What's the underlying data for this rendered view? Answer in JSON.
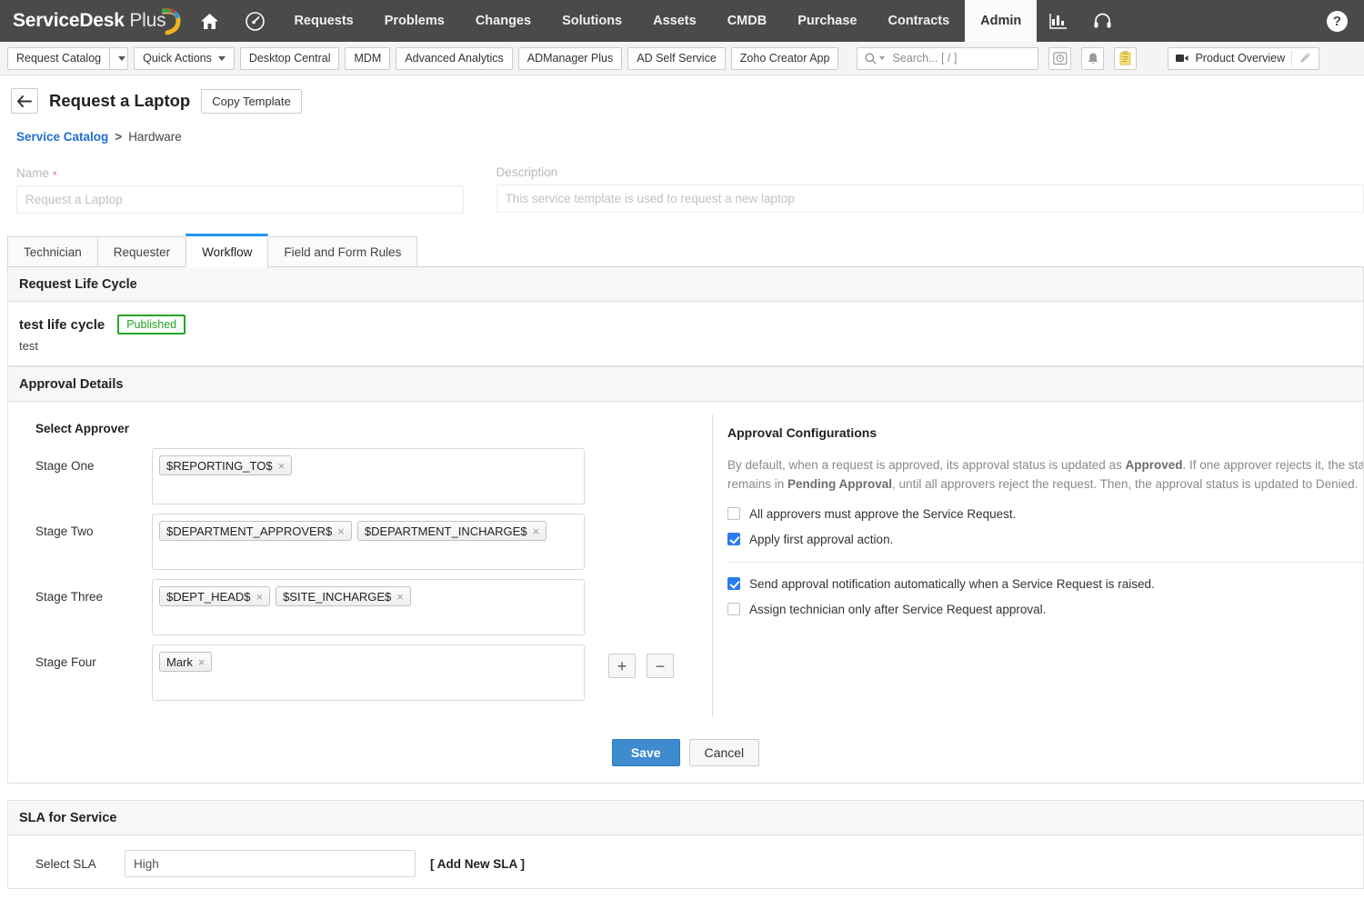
{
  "topnav": {
    "logo": "ServiceDesk",
    "logo_plus": "Plus",
    "items": [
      {
        "label": "Requests",
        "active": false
      },
      {
        "label": "Problems",
        "active": false
      },
      {
        "label": "Changes",
        "active": false
      },
      {
        "label": "Solutions",
        "active": false
      },
      {
        "label": "Assets",
        "active": false
      },
      {
        "label": "CMDB",
        "active": false
      },
      {
        "label": "Purchase",
        "active": false
      },
      {
        "label": "Contracts",
        "active": false
      },
      {
        "label": "Admin",
        "active": true
      }
    ],
    "help_label": "?"
  },
  "subbar": {
    "request_catalog": "Request Catalog",
    "quick_actions": "Quick Actions",
    "desktop_central": "Desktop Central",
    "mdm": "MDM",
    "advanced_analytics": "Advanced Analytics",
    "admanager_plus": "ADManager Plus",
    "ad_self_service": "AD Self Service",
    "zoho_creator_app": "Zoho Creator App",
    "search_placeholder": "Search... [ / ]",
    "product_overview": "Product Overview"
  },
  "page": {
    "title": "Request a Laptop",
    "copy_template": "Copy Template",
    "breadcrumb_root": "Service Catalog",
    "breadcrumb_sep": ">",
    "breadcrumb_current": "Hardware"
  },
  "form": {
    "name_label": "Name",
    "name_required": "•",
    "name_value": "Request a Laptop",
    "description_label": "Description",
    "description_value": "This service template is used to request a new laptop"
  },
  "tabs": [
    {
      "label": "Technician",
      "active": false
    },
    {
      "label": "Requester",
      "active": false
    },
    {
      "label": "Workflow",
      "active": true
    },
    {
      "label": "Field and Form Rules",
      "active": false
    }
  ],
  "lifecycle": {
    "panel_title": "Request Life Cycle",
    "name": "test life cycle",
    "status_badge": "Published",
    "description": "test"
  },
  "approval": {
    "panel_title": "Approval Details",
    "select_approver_label": "Select Approver",
    "stages": [
      {
        "label": "Stage One",
        "chips": [
          "$REPORTING_TO$"
        ]
      },
      {
        "label": "Stage Two",
        "chips": [
          "$DEPARTMENT_APPROVER$",
          "$DEPARTMENT_INCHARGE$"
        ]
      },
      {
        "label": "Stage Three",
        "chips": [
          "$DEPT_HEAD$",
          "$SITE_INCHARGE$"
        ]
      },
      {
        "label": "Stage Four",
        "chips": [
          "Mark"
        ]
      }
    ],
    "add_stage_label": "+",
    "remove_stage_label": "−",
    "config_title": "Approval Configurations",
    "config_paragraph_1": "By default, when a request is approved, its approval status is updated as ",
    "config_paragraph_bold_1": "Approved",
    "config_paragraph_2": ". If one approver rejects it, the status remains in ",
    "config_paragraph_bold_2": "Pending Approval",
    "config_paragraph_3": ", until all approvers reject the request. Then, the approval status is updated to Denied.",
    "checkboxes": [
      {
        "label": "All approvers must approve the Service Request.",
        "checked": false
      },
      {
        "label": "Apply first approval action.",
        "checked": true
      },
      {
        "label": "Send approval notification automatically when a Service Request is raised.",
        "checked": true
      },
      {
        "label": "Assign technician only after Service Request approval.",
        "checked": false
      }
    ],
    "save_label": "Save",
    "cancel_label": "Cancel"
  },
  "sla": {
    "panel_title": "SLA for Service",
    "select_label": "Select SLA",
    "select_value": "High",
    "add_new": "[ Add New SLA ]"
  },
  "colors": {
    "nav_bg": "#4a4a4a",
    "accent_blue": "#2196f3",
    "link_blue": "#1f6fd0",
    "badge_green": "#25a525",
    "primary_btn": "#3e8bd0",
    "checkbox_on": "#2a7cf0"
  }
}
